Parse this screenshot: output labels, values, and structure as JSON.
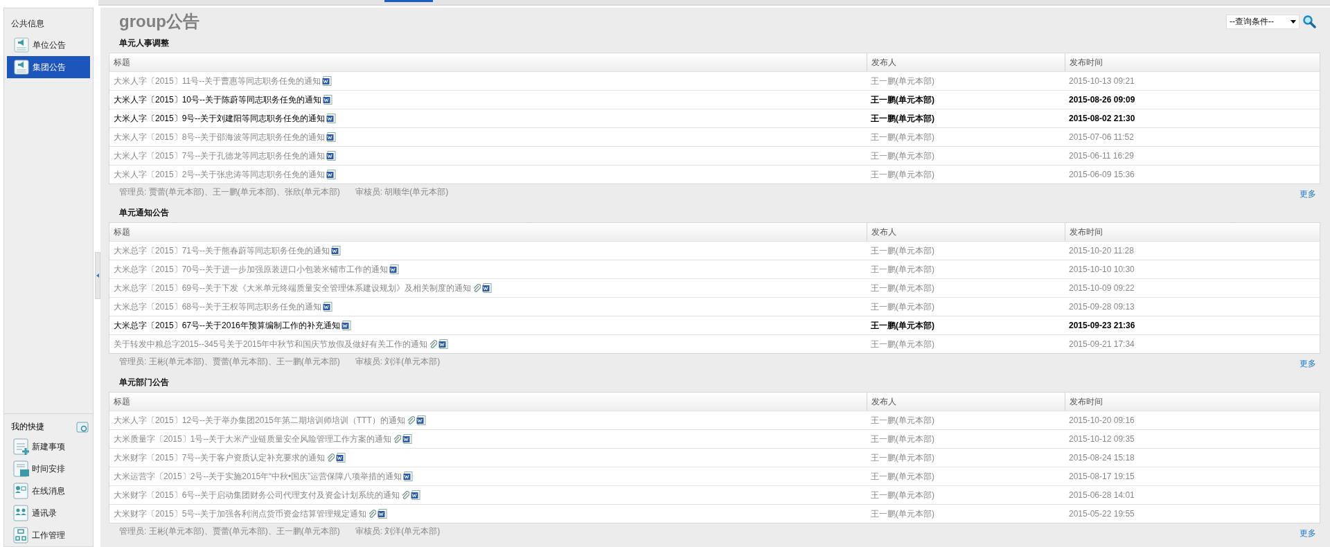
{
  "sidebar": {
    "public_title": "公共信息",
    "items": [
      {
        "label": "单位公告",
        "selected": false
      },
      {
        "label": "集团公告",
        "selected": true
      }
    ],
    "shortcuts_title": "我的快捷",
    "shortcuts": [
      {
        "label": "新建事项",
        "kind": "new"
      },
      {
        "label": "时间安排",
        "kind": "schedule"
      },
      {
        "label": "在线消息",
        "kind": "message"
      },
      {
        "label": "通讯录",
        "kind": "contacts"
      },
      {
        "label": "工作管理",
        "kind": "work"
      }
    ]
  },
  "page_title": "group公告",
  "query": {
    "value": "--查询条件--"
  },
  "sections": [
    {
      "title": "单元人事调整",
      "columns": [
        "标题",
        "发布人",
        "发布时间"
      ],
      "rows": [
        {
          "title": "大米人字〔2015〕11号--关于曹惠等同志职务任免的通知",
          "attachment": false,
          "publisher": "王一鹏(单元本部)",
          "time": "2015-10-13 09:21",
          "unread": false
        },
        {
          "title": "大米人字〔2015〕10号--关于陈蔚等同志职务任免的通知",
          "attachment": false,
          "publisher": "王一鹏(单元本部)",
          "time": "2015-08-26 09:09",
          "unread": true
        },
        {
          "title": "大米人字〔2015〕9号--关于刘建阳等同志职务任免的通知",
          "attachment": false,
          "publisher": "王一鹏(单元本部)",
          "time": "2015-08-02 21:30",
          "unread": true
        },
        {
          "title": "大米人字〔2015〕8号--关于邵海波等同志职务任免的通知",
          "attachment": false,
          "publisher": "王一鹏(单元本部)",
          "time": "2015-07-06 11:52",
          "unread": false
        },
        {
          "title": "大米人字〔2015〕7号--关于孔德龙等同志职务任免的通知",
          "attachment": false,
          "publisher": "王一鹏(单元本部)",
          "time": "2015-06-11 16:29",
          "unread": false
        },
        {
          "title": "大米人字〔2015〕2号--关于张忠涛等同志职务任免的通知",
          "attachment": false,
          "publisher": "王一鹏(单元本部)",
          "time": "2015-06-09 15:36",
          "unread": false
        }
      ],
      "admins": "管理员: 贾蕾(单元本部)、王一鹏(单元本部)、张欣(单元本部)",
      "reviewer": "审核员: 胡顺华(单元本部)",
      "more": "更多"
    },
    {
      "title": "单元通知公告",
      "columns": [
        "标题",
        "发布人",
        "发布时间"
      ],
      "rows": [
        {
          "title": "大米总字〔2015〕71号--关于熊春蔚等同志职务任免的通知",
          "attachment": false,
          "publisher": "王一鹏(单元本部)",
          "time": "2015-10-20 11:28",
          "unread": false
        },
        {
          "title": "大米总字〔2015〕70号--关于进一步加强原装进口小包装米铺市工作的通知",
          "attachment": false,
          "publisher": "王一鹏(单元本部)",
          "time": "2015-10-10 10:30",
          "unread": false
        },
        {
          "title": "大米总字〔2015〕69号--关于下发《大米单元终端质量安全管理体系建设规划》及相关制度的通知",
          "attachment": true,
          "publisher": "王一鹏(单元本部)",
          "time": "2015-10-09 09:22",
          "unread": false
        },
        {
          "title": "大米总字〔2015〕68号--关于王权等同志职务任免的通知",
          "attachment": false,
          "publisher": "王一鹏(单元本部)",
          "time": "2015-09-28 09:13",
          "unread": false
        },
        {
          "title": "大米总字〔2015〕67号--关于2016年预算编制工作的补充通知",
          "attachment": false,
          "publisher": "王一鹏(单元本部)",
          "time": "2015-09-23 21:36",
          "unread": true
        },
        {
          "title": "关于转发中粮总字2015--345号关于2015年中秋节和国庆节放假及做好有关工作的通知",
          "attachment": true,
          "publisher": "王一鹏(单元本部)",
          "time": "2015-09-21 17:34",
          "unread": false
        }
      ],
      "admins": "管理员: 王彬(单元本部)、贾蕾(单元本部)、王一鹏(单元本部)",
      "reviewer": "审核员: 刘洋(单元本部)",
      "more": "更多"
    },
    {
      "title": "单元部门公告",
      "columns": [
        "标题",
        "发布人",
        "发布时间"
      ],
      "rows": [
        {
          "title": "大米人字〔2015〕12号--关于举办集团2015年第二期培训师培训（TTT）的通知",
          "attachment": true,
          "publisher": "王一鹏(单元本部)",
          "time": "2015-10-20 09:16",
          "unread": false
        },
        {
          "title": "大米质量字〔2015〕1号--关于大米产业链质量安全风险管理工作方案的通知",
          "attachment": true,
          "publisher": "王一鹏(单元本部)",
          "time": "2015-10-12 09:35",
          "unread": false
        },
        {
          "title": "大米财字〔2015〕7号--关于客户资质认定补充要求的通知",
          "attachment": true,
          "publisher": "王一鹏(单元本部)",
          "time": "2015-08-24 15:18",
          "unread": false
        },
        {
          "title": "大米运营字〔2015〕2号--关于实施2015年“中秋•国庆”运营保障八项举措的通知",
          "attachment": false,
          "publisher": "王一鹏(单元本部)",
          "time": "2015-08-17 19:15",
          "unread": false
        },
        {
          "title": "大米财字〔2015〕6号--关于启动集团财务公司代理支付及资金计划系统的通知",
          "attachment": true,
          "publisher": "王一鹏(单元本部)",
          "time": "2015-06-28 14:01",
          "unread": false
        },
        {
          "title": "大米财字〔2015〕5号--关于加强各利润点货币资金结算管理规定通知",
          "attachment": true,
          "publisher": "王一鹏(单元本部)",
          "time": "2015-05-22 19:55",
          "unread": false
        }
      ],
      "admins": "管理员: 王彬(单元本部)、贾蕾(单元本部)、王一鹏(单元本部)",
      "reviewer": "审核员: 刘洋(单元本部)",
      "more": "更多"
    }
  ]
}
